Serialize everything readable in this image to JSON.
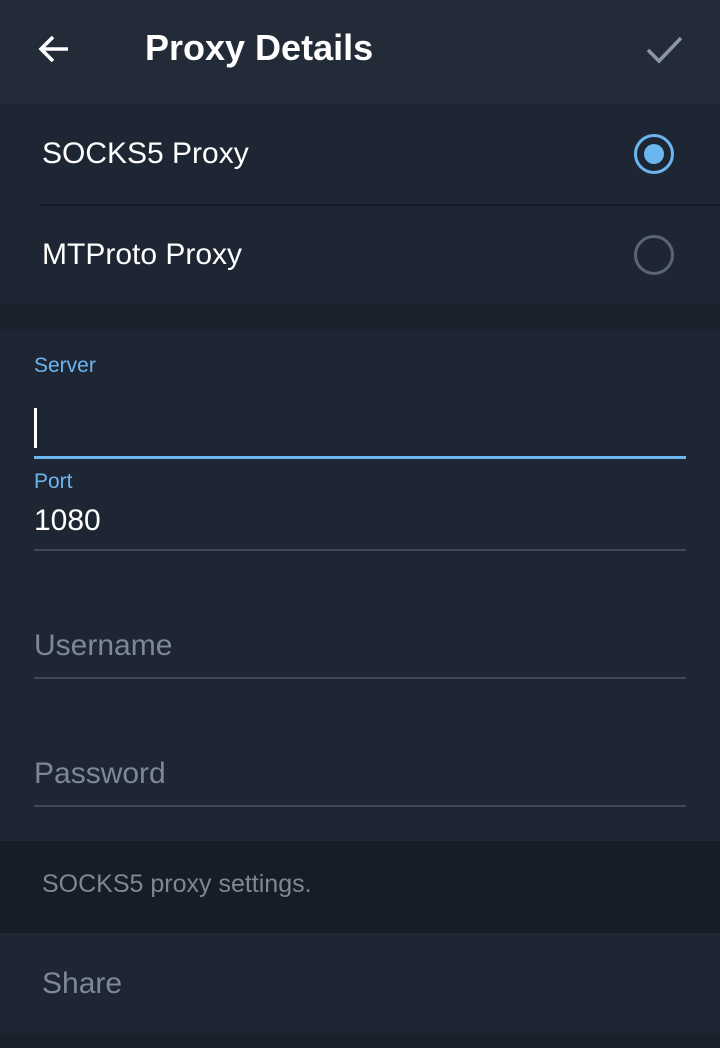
{
  "header": {
    "title": "Proxy Details",
    "back_icon": "arrow-left-icon",
    "done_icon": "checkmark-icon"
  },
  "proxy_types": [
    {
      "label": "SOCKS5 Proxy",
      "selected": true
    },
    {
      "label": "MTProto Proxy",
      "selected": false
    }
  ],
  "form": {
    "server": {
      "label": "Server",
      "value": ""
    },
    "port": {
      "label": "Port",
      "value": "1080"
    },
    "username": {
      "placeholder": "Username",
      "value": ""
    },
    "password": {
      "placeholder": "Password",
      "value": ""
    }
  },
  "info": {
    "text": "SOCKS5 proxy settings."
  },
  "share": {
    "label": "Share"
  },
  "colors": {
    "accent": "#6cb6ef",
    "header_bg": "#232b39",
    "section_bg": "#1e2633",
    "screen_bg": "#1a212b",
    "muted_text": "#7d8795"
  }
}
